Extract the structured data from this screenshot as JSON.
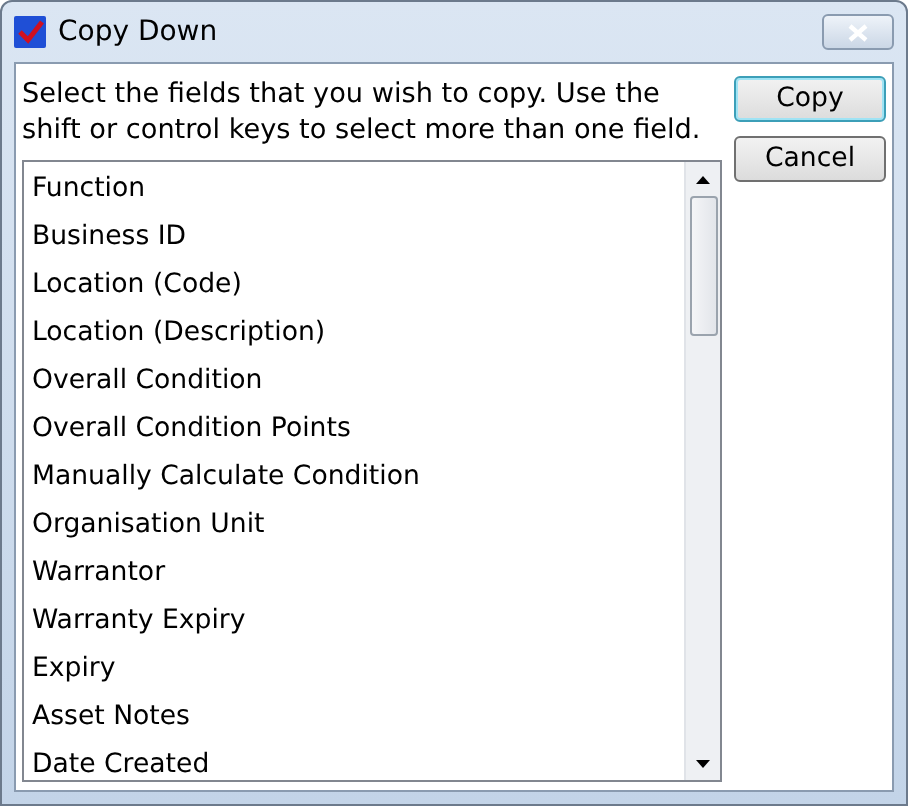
{
  "window": {
    "title": "Copy Down"
  },
  "instructions": "Select the fields that you wish to copy. Use the shift or control keys to select more than one field.",
  "fields": [
    {
      "label": "Function",
      "selected": false
    },
    {
      "label": "Business ID",
      "selected": false
    },
    {
      "label": "Location (Code)",
      "selected": false
    },
    {
      "label": "Location (Description)",
      "selected": false
    },
    {
      "label": "Overall Condition",
      "selected": false
    },
    {
      "label": "Overall Condition Points",
      "selected": false
    },
    {
      "label": "Manually Calculate Condition",
      "selected": false
    },
    {
      "label": "Organisation Unit",
      "selected": false
    },
    {
      "label": "Warrantor",
      "selected": false
    },
    {
      "label": "Warranty Expiry",
      "selected": false
    },
    {
      "label": "Expiry",
      "selected": false
    },
    {
      "label": "Asset Notes",
      "selected": false
    },
    {
      "label": "Date Created",
      "selected": false
    }
  ],
  "buttons": [
    {
      "label": "Copy",
      "default": true
    },
    {
      "label": "Cancel",
      "default": false
    }
  ]
}
